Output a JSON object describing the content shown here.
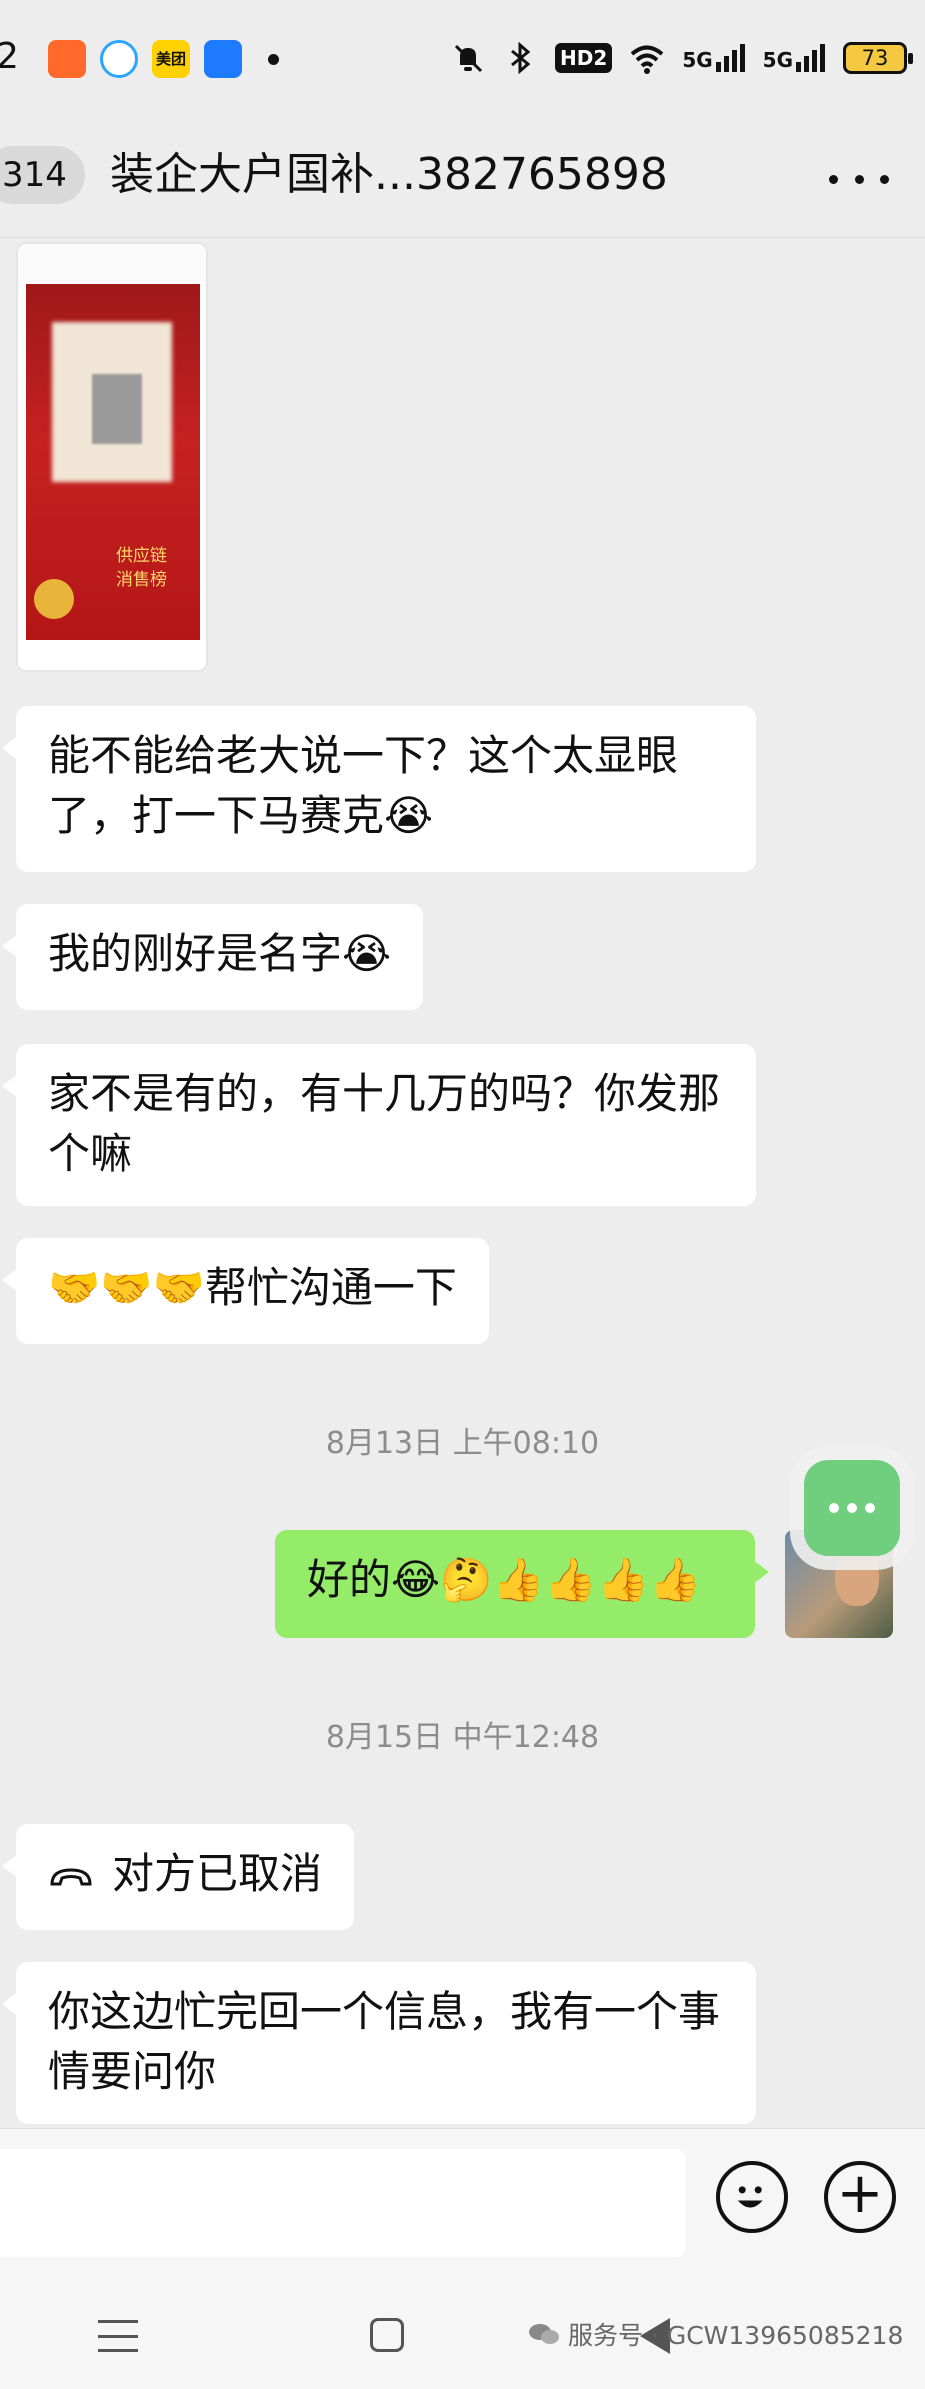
{
  "status_bar": {
    "time": "2",
    "apps": [
      "美团"
    ],
    "network_1": "5G",
    "network_2": "5G",
    "hd": "HD2",
    "battery": "73"
  },
  "header": {
    "unread_count": "314",
    "title": "装企大户国补...382765898"
  },
  "messages": {
    "m1": "能不能给老大说一下？这个太显眼了，打一下马赛克😭",
    "m2": "我的刚好是名字😭",
    "m3": "家不是有的，有十几万的吗？你发那个嘛",
    "m4": "🤝🤝🤝帮忙沟通一下",
    "ts1": "8月13日 上午08:10",
    "m5": "好的😂🤔👍👍👍👍",
    "ts2": "8月15日 中午12:48",
    "m6": "对方已取消",
    "m7": "你这边忙完回一个信息，我有一个事情要问你"
  },
  "image_message": {
    "text": "供应链\n消售榜"
  },
  "watermark": {
    "text": "服务号 · GCW13965085218"
  },
  "icons": {
    "more": "more-icon",
    "emoji": "emoji-icon",
    "plus": "plus-icon",
    "phone": "phone-cancel-icon"
  },
  "colors": {
    "self_bubble": "#95ec69",
    "other_bubble": "#ffffff",
    "background": "#ededed"
  }
}
